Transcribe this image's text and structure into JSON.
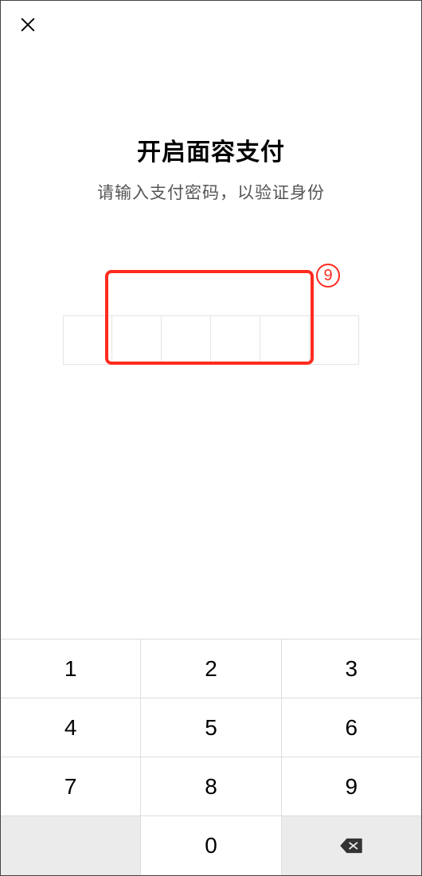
{
  "header": {
    "close_label": "close"
  },
  "title": "开启面容支付",
  "subtitle": "请输入支付密码，以验证身份",
  "pin": {
    "length": 6
  },
  "annotation": {
    "badge": "9"
  },
  "keypad": {
    "keys": [
      "1",
      "2",
      "3",
      "4",
      "5",
      "6",
      "7",
      "8",
      "9",
      "",
      "0"
    ],
    "backspace_label": "backspace"
  }
}
